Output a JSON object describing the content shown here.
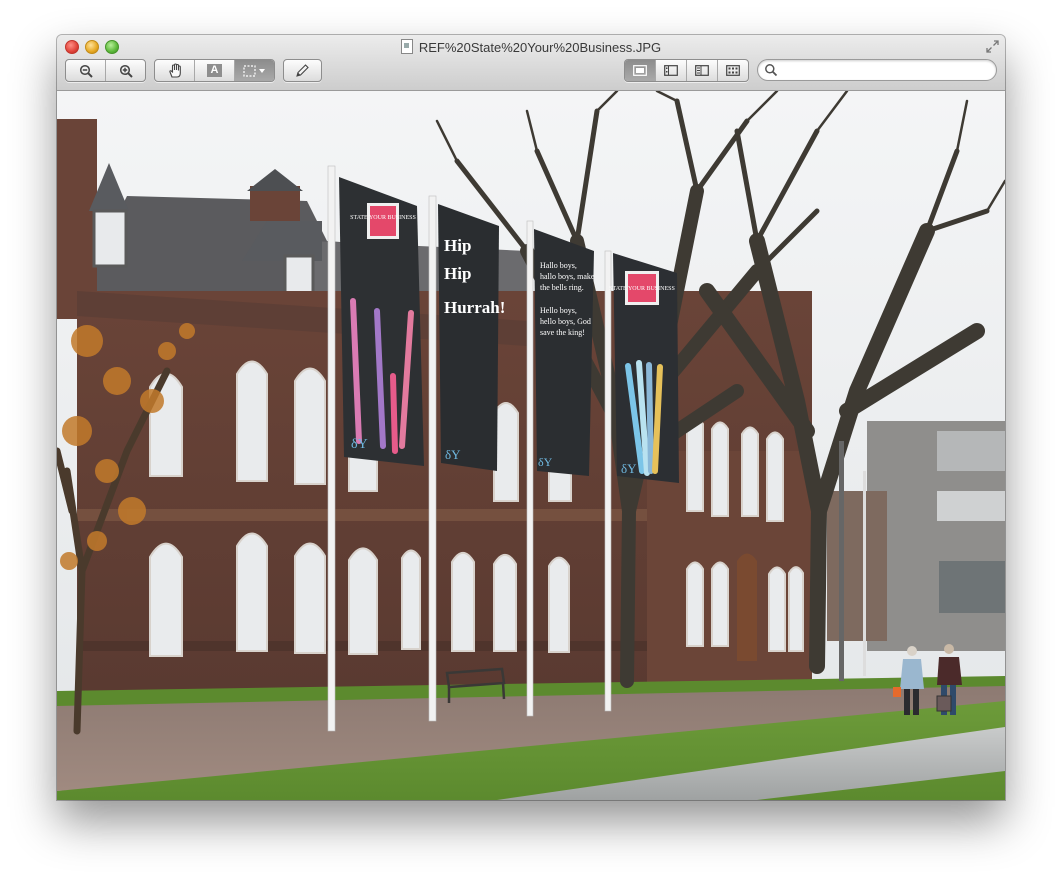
{
  "window": {
    "title": "REF%20State%20Your%20Business.JPG"
  },
  "toolbar": {
    "zoom_out_icon": "magnifier-minus-icon",
    "zoom_in_icon": "magnifier-plus-icon",
    "hand_tool_icon": "hand-icon",
    "text_tool_label": "A",
    "select_tool_icon": "dashed-rectangle-icon",
    "markup_tool_icon": "pencil-icon",
    "view_icons": [
      "single-image-icon",
      "thumbnail-sidebar-icon",
      "sidebar-split-icon",
      "contact-sheet-icon"
    ]
  },
  "search": {
    "placeholder": "",
    "value": ""
  },
  "photo": {
    "flag1_logo": "STATE YOUR BUSINESS",
    "flag1_tag": "δY",
    "flag2_lines": [
      "Hip",
      "Hip",
      "Hurrah!"
    ],
    "flag2_tag": "δY",
    "flag3_lines": [
      "Hallo boys,",
      "hallo boys, make",
      "the bells ring.",
      "Hello boys,",
      "hello boys, God",
      "save the king!"
    ],
    "flag3_tag": "δY",
    "flag4_logo": "STATE YOUR BUSINESS",
    "flag4_tag": "δY"
  }
}
